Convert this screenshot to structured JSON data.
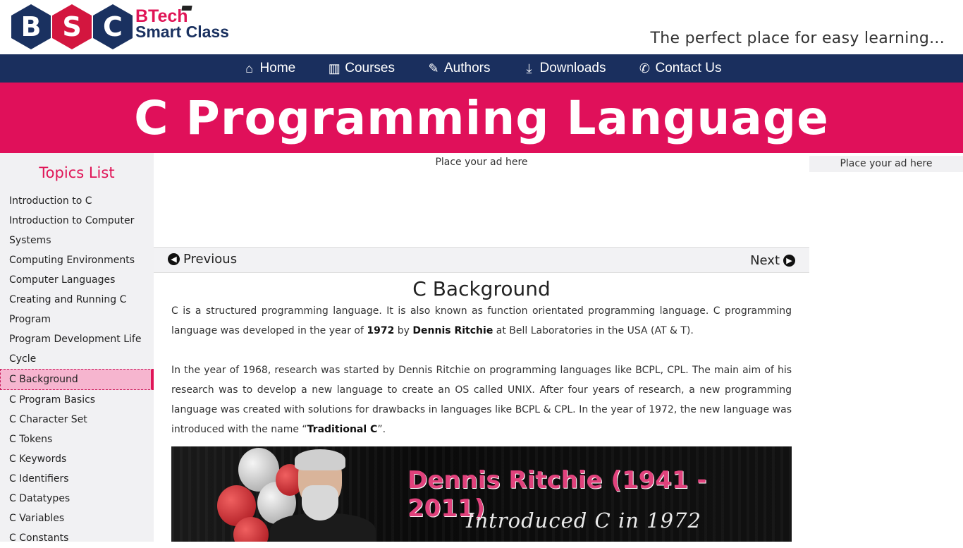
{
  "logo": {
    "letters": [
      "B",
      "S",
      "C"
    ],
    "line1": "BTech",
    "line2": "Smart Class"
  },
  "tagline": "The perfect place for easy learning...",
  "nav": [
    {
      "label": "Home",
      "icon": "home-icon"
    },
    {
      "label": "Courses",
      "icon": "bar-chart-icon"
    },
    {
      "label": "Authors",
      "icon": "pencil-icon"
    },
    {
      "label": "Downloads",
      "icon": "download-icon"
    },
    {
      "label": "Contact Us",
      "icon": "phone-icon"
    }
  ],
  "banner_title": "C Programming Language",
  "sidebar": {
    "heading": "Topics List",
    "topics": [
      "Introduction to C",
      "Introduction to Computer",
      "Systems",
      "Computing Environments",
      "Computer Languages",
      "Creating and Running C",
      "Program",
      "Program Development Life",
      "Cycle",
      "C Background",
      "C Program Basics",
      "C Character Set",
      "C Tokens",
      "C Keywords",
      "C Identifiers",
      "C Datatypes",
      "C Variables",
      "C Constants"
    ],
    "active_index": 9
  },
  "ads": {
    "main": "Place your ad here",
    "right": "Place your ad here"
  },
  "pager": {
    "previous": "Previous",
    "next": "Next"
  },
  "content": {
    "title": "C Background",
    "p1_a": "C is a structured programming language. It is also known as function orientated programming language. C programming language was developed in the year of ",
    "p1_year": "1972",
    "p1_b": " by ",
    "p1_name": "Dennis Ritchie",
    "p1_c": " at Bell Laboratories in the USA (AT & T).",
    "p2_a": "In the year of 1968, research was started by Dennis Ritchie on programming languages like BCPL, CPL. The main aim of his research was to develop a new language to create an OS called UNIX. After four years of research, a new programming language was created with solutions for drawbacks in languages like BCPL & CPL. In the year of 1972, the new language was introduced with the name “",
    "p2_bold": "Traditional C",
    "p2_b": "”."
  },
  "image": {
    "title": "Dennis Ritchie (1941 - 2011)",
    "subtitle": "Introduced C in 1972"
  },
  "colors": {
    "brand_pink": "#e01557",
    "brand_navy": "#1a2f5e",
    "sidebar_bg": "#f1f1f3",
    "active_topic_bg": "#f6b5cf"
  }
}
